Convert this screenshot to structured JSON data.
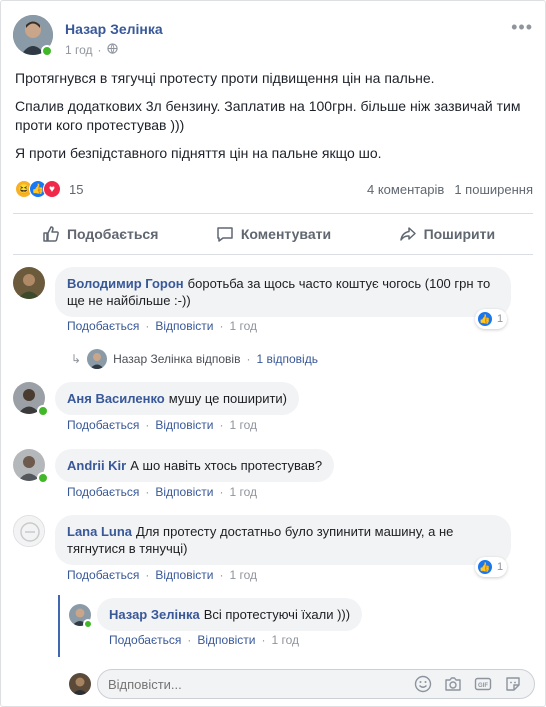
{
  "post": {
    "author": "Назар Зелінка",
    "time": "1 год",
    "paragraphs": [
      "Протягнувся в тягучці протесту проти підвищення цін на пальне.",
      "Спалив додаткових 3л бензину. Заплатив на 100грн. більше ніж зазвичай тим проти кого протестував )))",
      "Я проти безпідставного підняття цін на пальне якщо шо."
    ],
    "reactions_count": "15",
    "comments_count": "4 коментарів",
    "shares_count": "1 поширення",
    "reaction_icons": [
      "haha-icon",
      "like-icon",
      "love-icon"
    ]
  },
  "actions": {
    "like": "Подобається",
    "comment": "Коментувати",
    "share": "Поширити"
  },
  "comment_actions": {
    "like": "Подобається",
    "reply": "Відповісти"
  },
  "comments": [
    {
      "author": "Володимир Горон",
      "text": "боротьба за щось часто коштує чогось (100 грн то ще не найбільше :-))",
      "time": "1 год",
      "likes": "1",
      "replies_summary": {
        "author": "Назар Зелінка",
        "verb": "відповів",
        "count": "1 відповідь"
      }
    },
    {
      "author": "Аня Василенко",
      "text": "мушу це поширити)",
      "time": "1 год"
    },
    {
      "author": "Andrii Kir",
      "text": "А шо навіть хтось протестував?",
      "time": "1 год"
    },
    {
      "author": "Lana Luna",
      "text": "Для протесту достатньо було зупинити машину, а не тягнутися в тянучці)",
      "time": "1 год",
      "likes": "1",
      "reply": {
        "author": "Назар Зелінка",
        "text": "Всі протестуючі їхали )))",
        "time": "1 год"
      }
    }
  ],
  "composer": {
    "placeholder": "Відповісти..."
  },
  "colors": {
    "link": "#385898",
    "like": "#1877f2",
    "love": "#f0284a",
    "haha": "#f7b125",
    "online": "#42b72a",
    "thread_line": "#4267b2"
  }
}
